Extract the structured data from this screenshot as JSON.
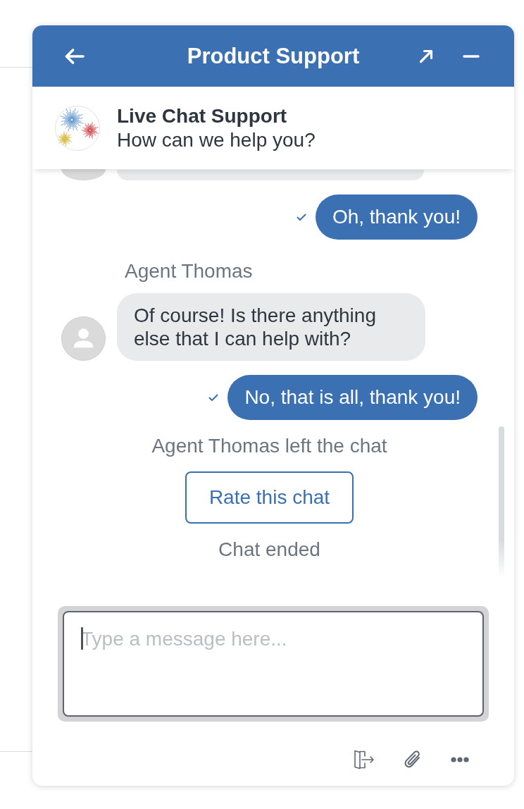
{
  "header": {
    "title": "Product Support"
  },
  "agent_card": {
    "name": "Live Chat Support",
    "subtitle": "How can we help you?"
  },
  "messages": [
    {
      "kind": "agent_cutoff"
    },
    {
      "kind": "sent",
      "text": "Oh, thank you!",
      "delivered": true
    },
    {
      "kind": "agent",
      "sender": "Agent Thomas",
      "text": "Of course! Is there anything else that I can help with?"
    },
    {
      "kind": "sent",
      "text": "No, that is all, thank you!",
      "delivered": true
    },
    {
      "kind": "notice",
      "text": "Agent Thomas left the chat"
    },
    {
      "kind": "action",
      "label": "Rate this chat"
    },
    {
      "kind": "notice",
      "text": "Chat ended"
    }
  ],
  "composer": {
    "placeholder": "Type a message here...",
    "focused": true
  }
}
